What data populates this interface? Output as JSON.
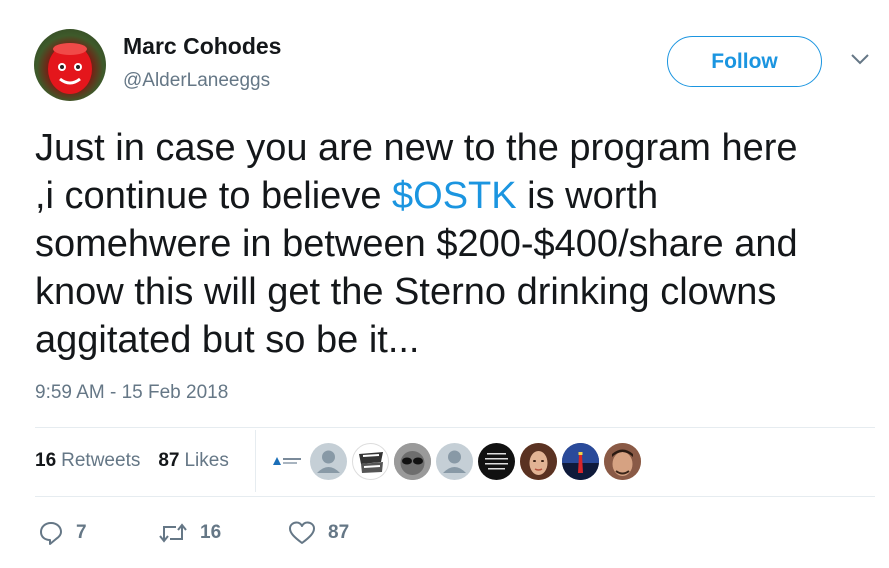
{
  "author": {
    "name": "Marc Cohodes",
    "handle": "@AlderLaneeggs"
  },
  "follow_label": "Follow",
  "tweet": {
    "lines": [
      {
        "before": "Just in case you are new to the program here",
        "cashtag": "",
        "after": ""
      },
      {
        "before": ",i continue to believe ",
        "cashtag": "$OSTK",
        "after": " is worth"
      },
      {
        "before": "somehwere in between $200-$400/share  and",
        "cashtag": "",
        "after": ""
      },
      {
        "before": "know this will get the Sterno drinking clowns",
        "cashtag": "",
        "after": ""
      },
      {
        "before": "aggitated but so be it...",
        "cashtag": "",
        "after": ""
      }
    ],
    "timestamp": "9:59 AM - 15 Feb 2018"
  },
  "stats": {
    "retweets_count": "16",
    "retweets_label": "Retweets",
    "likes_count": "87",
    "likes_label": "Likes"
  },
  "actions": {
    "reply_count": "7",
    "retweet_count": "16",
    "like_count": "87"
  },
  "liker_avatars": [
    "logo-avatar",
    "default-avatar",
    "text-logo-avatar",
    "sunglasses-avatar",
    "default-avatar",
    "text-quote-avatar",
    "woman-avatar",
    "lighthouse-avatar",
    "man-avatar"
  ],
  "colors": {
    "accent": "#1b95e0",
    "secondary_text": "#657786",
    "primary_text": "#14171a",
    "divider": "#e6ecf0"
  }
}
